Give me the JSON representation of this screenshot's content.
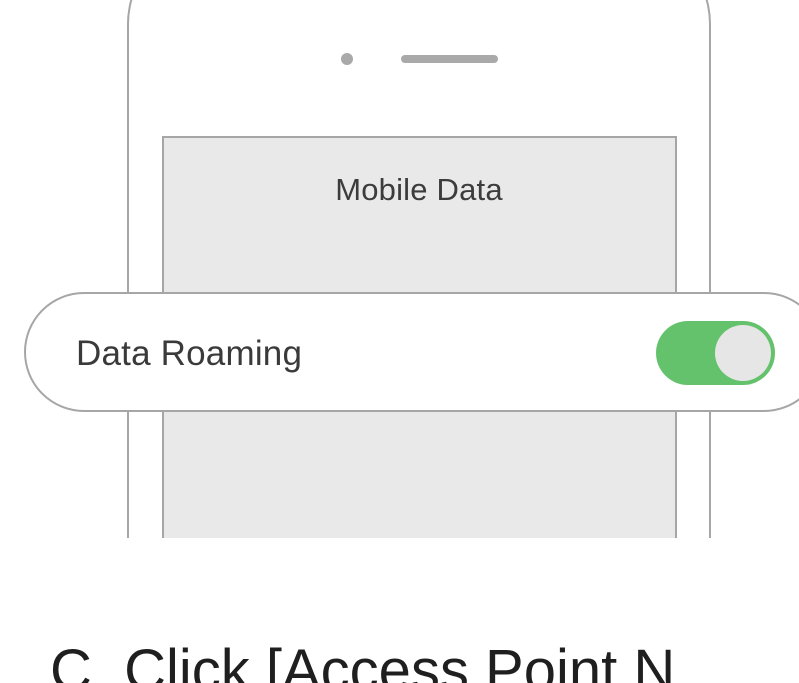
{
  "phone_screen": {
    "title": "Mobile Data"
  },
  "setting": {
    "label": "Data Roaming",
    "toggle_state": "on"
  },
  "caption": {
    "text": "C. Click [Access Point N"
  },
  "colors": {
    "toggle_on": "#64c26c",
    "toggle_knob": "#e6e6e6",
    "outline": "#a6a6a6",
    "screen_bg": "#e9e9e9"
  },
  "icons": {
    "camera": "camera-dot-icon",
    "speaker": "speaker-slot-icon"
  }
}
